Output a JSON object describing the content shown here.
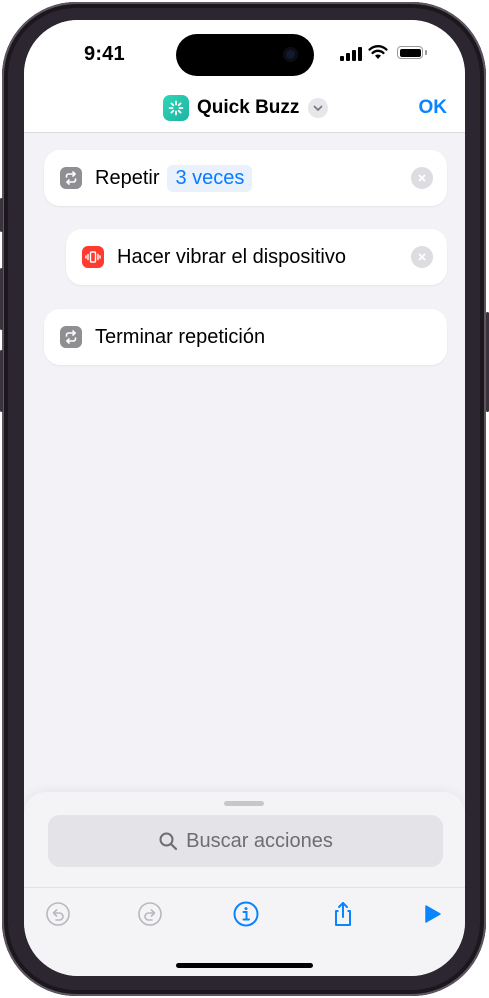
{
  "status_bar": {
    "time": "9:41"
  },
  "navbar": {
    "shortcut_name": "Quick Buzz",
    "app_icon": "sparkle-icon",
    "name_menu_icon": "chevron-down-icon",
    "done_label": "OK",
    "accent_color": "#0a84ff"
  },
  "actions": [
    {
      "label": "Repetir",
      "token": "3 veces",
      "icon": "repeat-icon",
      "icon_color": "#8e8e93",
      "removable": true
    },
    {
      "label": "Hacer vibrar el dispositivo",
      "icon": "vibrate-device-icon",
      "icon_color": "#ff3b30",
      "removable": true
    },
    {
      "label": "Terminar repetición",
      "icon": "repeat-icon",
      "icon_color": "#8e8e93",
      "removable": false
    }
  ],
  "search": {
    "placeholder": "Buscar acciones",
    "icon": "search-icon"
  },
  "toolbar": {
    "undo_icon": "undo-icon",
    "redo_icon": "redo-icon",
    "info_icon": "info-icon",
    "share_icon": "share-icon",
    "run_icon": "play-icon"
  }
}
